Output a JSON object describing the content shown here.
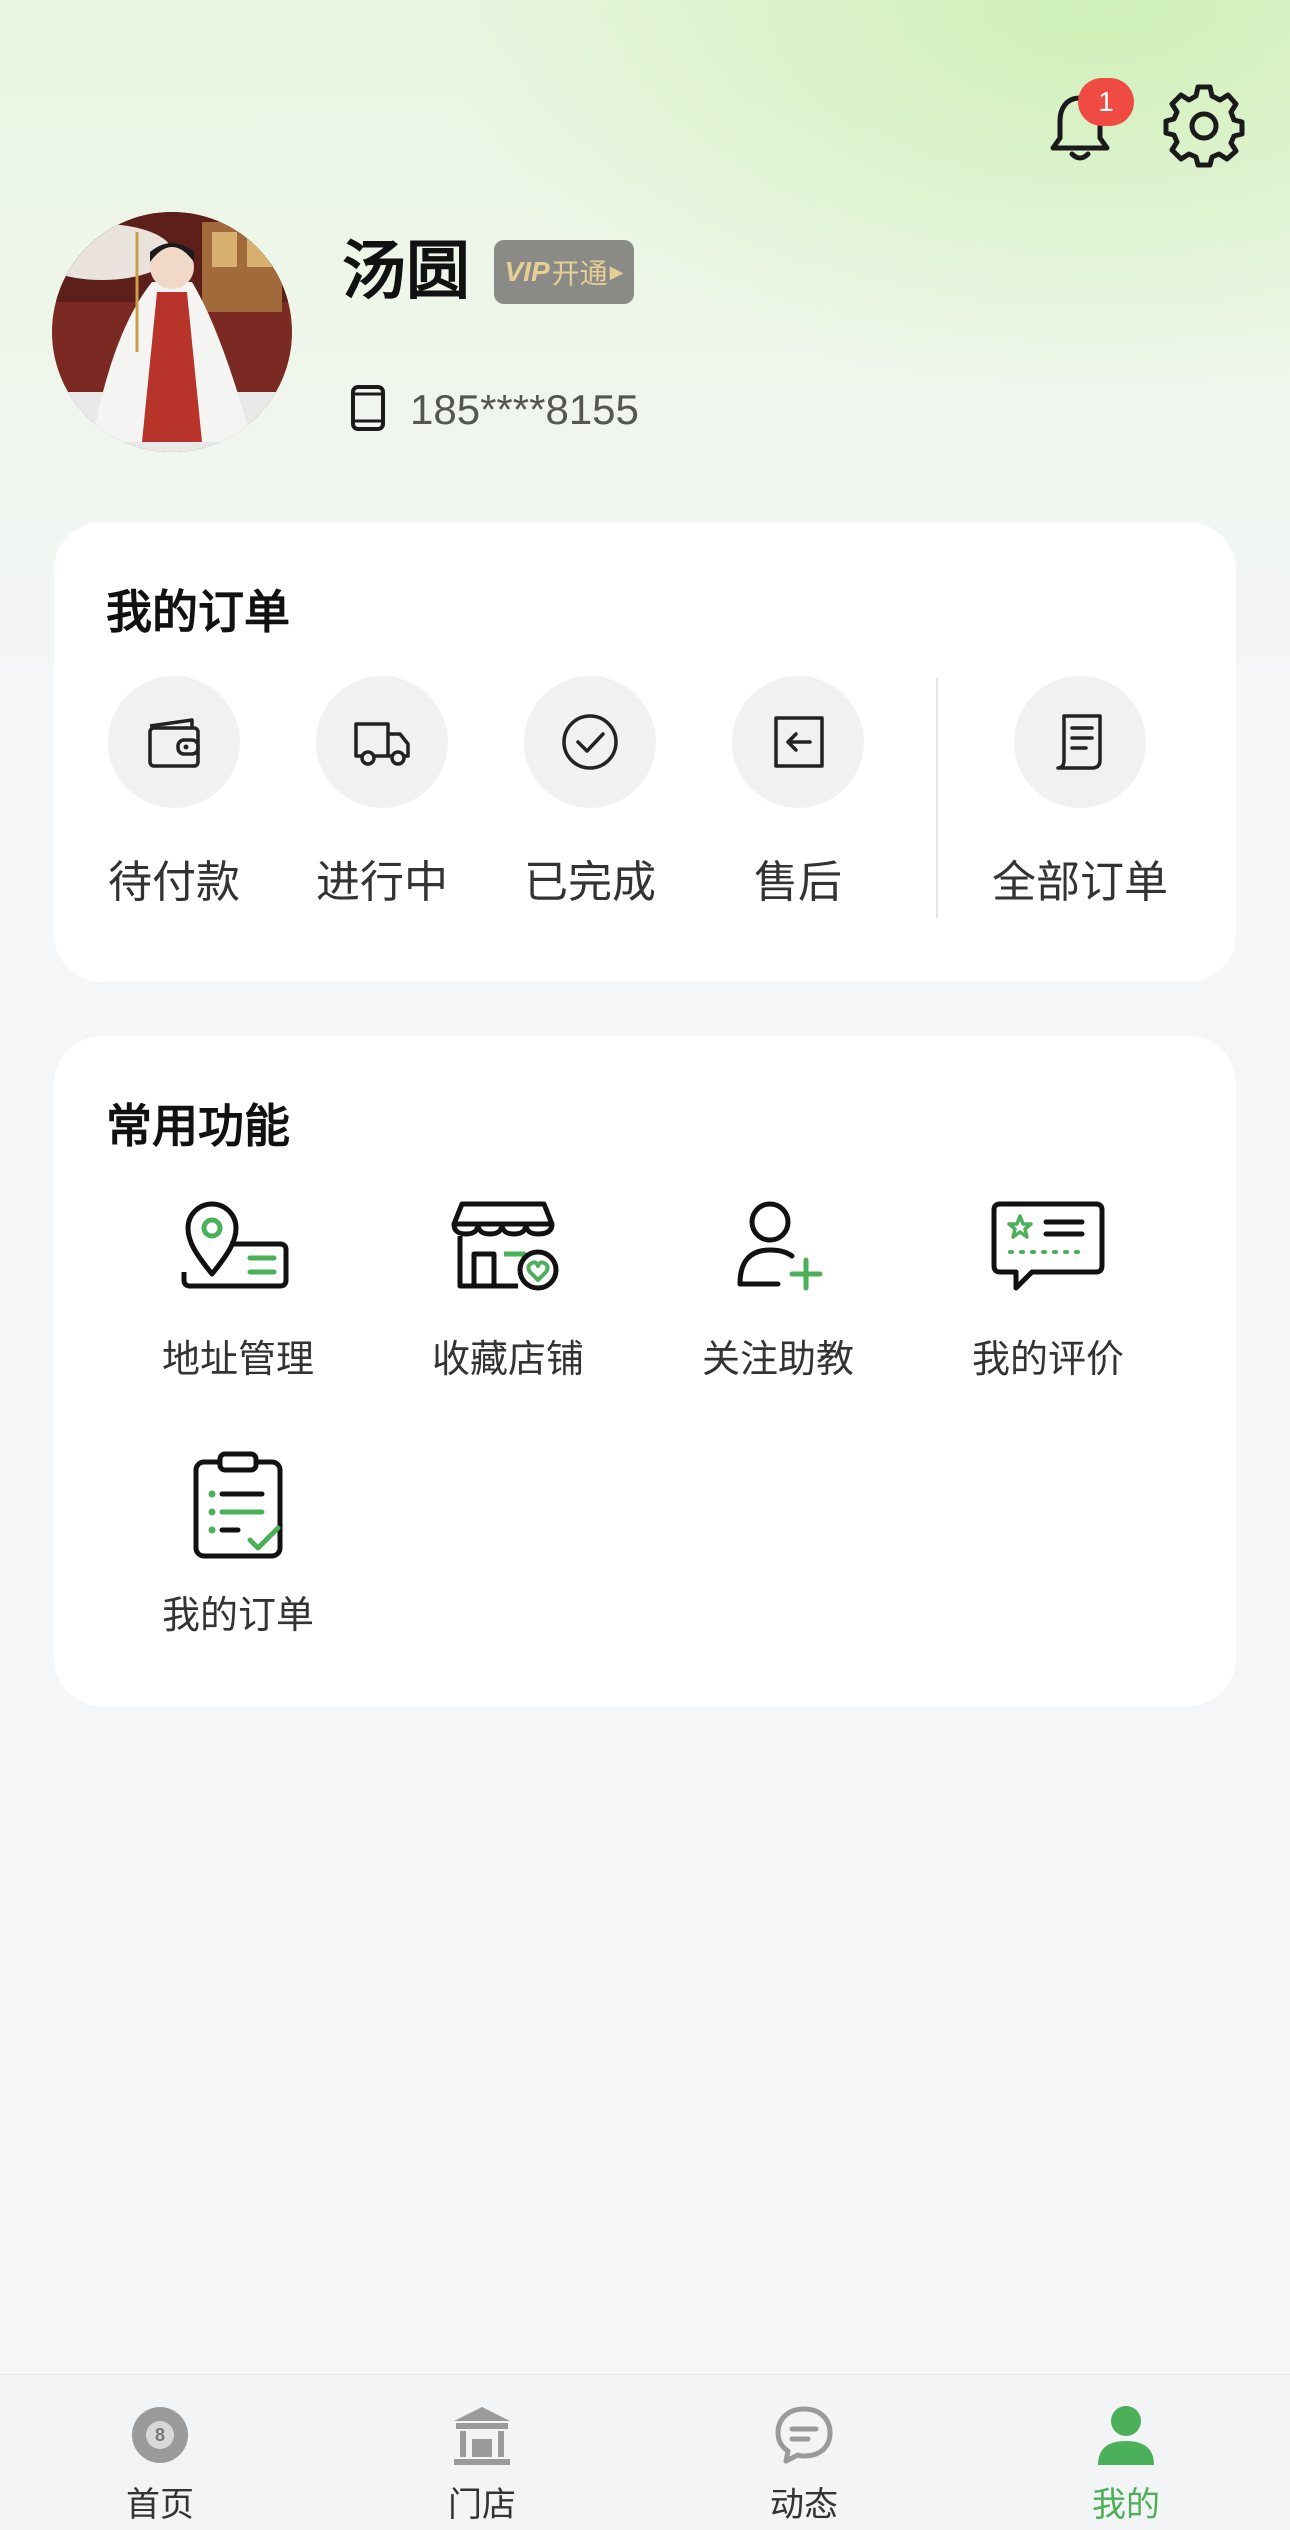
{
  "header": {
    "notification_count": "1"
  },
  "profile": {
    "name": "汤圆",
    "vip_mark": "VIP",
    "vip_action": "开通",
    "phone": "185****8155"
  },
  "orders": {
    "title": "我的订单",
    "items": [
      {
        "label": "待付款",
        "icon": "wallet-icon"
      },
      {
        "label": "进行中",
        "icon": "truck-icon"
      },
      {
        "label": "已完成",
        "icon": "check-circle-icon"
      },
      {
        "label": "售后",
        "icon": "return-icon"
      },
      {
        "label": "全部订单",
        "icon": "receipt-icon"
      }
    ]
  },
  "functions": {
    "title": "常用功能",
    "items": [
      {
        "label": "地址管理",
        "icon": "address-icon"
      },
      {
        "label": "收藏店铺",
        "icon": "favorite-store-icon"
      },
      {
        "label": "关注助教",
        "icon": "follow-user-icon"
      },
      {
        "label": "我的评价",
        "icon": "review-icon"
      },
      {
        "label": "我的订单",
        "icon": "order-list-icon"
      }
    ]
  },
  "nav": {
    "items": [
      {
        "label": "首页",
        "icon": "billiard-ball-icon"
      },
      {
        "label": "门店",
        "icon": "store-icon"
      },
      {
        "label": "动态",
        "icon": "chat-bubble-icon"
      },
      {
        "label": "我的",
        "icon": "user-icon",
        "active": true
      }
    ]
  },
  "colors": {
    "accent_green": "#4caf5a",
    "badge_red": "#ef4b43",
    "vip_gold": "#e6cf95"
  }
}
